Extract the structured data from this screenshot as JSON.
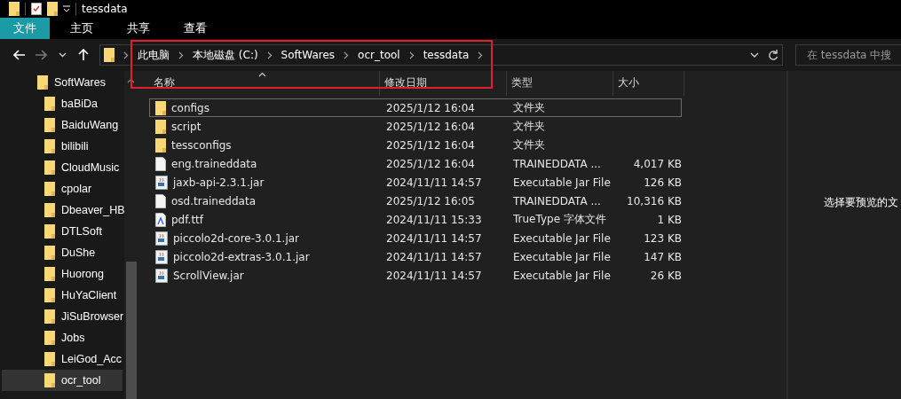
{
  "window": {
    "title": "tessdata"
  },
  "ribbon_tabs": [
    {
      "label": "文件",
      "selected": true
    },
    {
      "label": "主页",
      "selected": false
    },
    {
      "label": "共享",
      "selected": false
    },
    {
      "label": "查看",
      "selected": false
    }
  ],
  "breadcrumbs": [
    "此电脑",
    "本地磁盘 (C:)",
    "SoftWares",
    "ocr_tool",
    "tessdata"
  ],
  "search": {
    "placeholder": "在 tessdata 中搜"
  },
  "sidebar": {
    "items": [
      {
        "label": "SoftWares",
        "selected": false,
        "children": [
          {
            "label": "baBiDa",
            "selected": false
          },
          {
            "label": "BaiduWang",
            "selected": false
          },
          {
            "label": "bilibili",
            "selected": false
          },
          {
            "label": "CloudMusic",
            "selected": false
          },
          {
            "label": "cpolar",
            "selected": false
          },
          {
            "label": "Dbeaver_HB",
            "selected": false
          },
          {
            "label": "DTLSoft",
            "selected": false
          },
          {
            "label": "DuShe",
            "selected": false
          },
          {
            "label": "Huorong",
            "selected": false
          },
          {
            "label": "HuYaClient",
            "selected": false
          },
          {
            "label": "JiSuBrowser",
            "selected": false
          },
          {
            "label": "Jobs",
            "selected": false
          },
          {
            "label": "LeiGod_Acc",
            "selected": false
          },
          {
            "label": "ocr_tool",
            "selected": true
          }
        ]
      }
    ]
  },
  "table": {
    "columns": [
      {
        "label": "名称",
        "sorted": true
      },
      {
        "label": "修改日期",
        "sorted": false
      },
      {
        "label": "类型",
        "sorted": false
      },
      {
        "label": "大小",
        "sorted": false
      }
    ],
    "rows": [
      {
        "name": "configs",
        "modified": "2025/1/12 16:04",
        "type": "文件夹",
        "kind": "folder",
        "focused": true
      },
      {
        "name": "script",
        "modified": "2025/1/12 16:04",
        "type": "文件夹",
        "kind": "folder",
        "focused": false
      },
      {
        "name": "tessconfigs",
        "modified": "2025/1/12 16:04",
        "type": "文件夹",
        "kind": "folder",
        "focused": false
      },
      {
        "name": "eng.traineddata",
        "modified": "2025/1/12 16:04",
        "type": "TRAINEDDATA ...",
        "size": "4,017 KB",
        "kind": "file",
        "focused": false
      },
      {
        "name": "jaxb-api-2.3.1.jar",
        "modified": "2024/11/11 14:57",
        "type": "Executable Jar File",
        "size": "126 KB",
        "kind": "jar",
        "focused": false
      },
      {
        "name": "osd.traineddata",
        "modified": "2025/1/12 16:05",
        "type": "TRAINEDDATA ...",
        "size": "10,316 KB",
        "kind": "file",
        "focused": false
      },
      {
        "name": "pdf.ttf",
        "modified": "2024/11/11 15:33",
        "type": "TrueType 字体文件",
        "size": "1 KB",
        "kind": "font",
        "focused": false
      },
      {
        "name": "piccolo2d-core-3.0.1.jar",
        "modified": "2024/11/11 14:57",
        "type": "Executable Jar File",
        "size": "123 KB",
        "kind": "jar",
        "focused": false
      },
      {
        "name": "piccolo2d-extras-3.0.1.jar",
        "modified": "2024/11/11 14:57",
        "type": "Executable Jar File",
        "size": "147 KB",
        "kind": "jar",
        "focused": false
      },
      {
        "name": "ScrollView.jar",
        "modified": "2024/11/11 14:57",
        "type": "Executable Jar File",
        "size": "26 KB",
        "kind": "jar",
        "focused": false
      }
    ]
  },
  "preview": {
    "message": "选择要预览的文"
  }
}
